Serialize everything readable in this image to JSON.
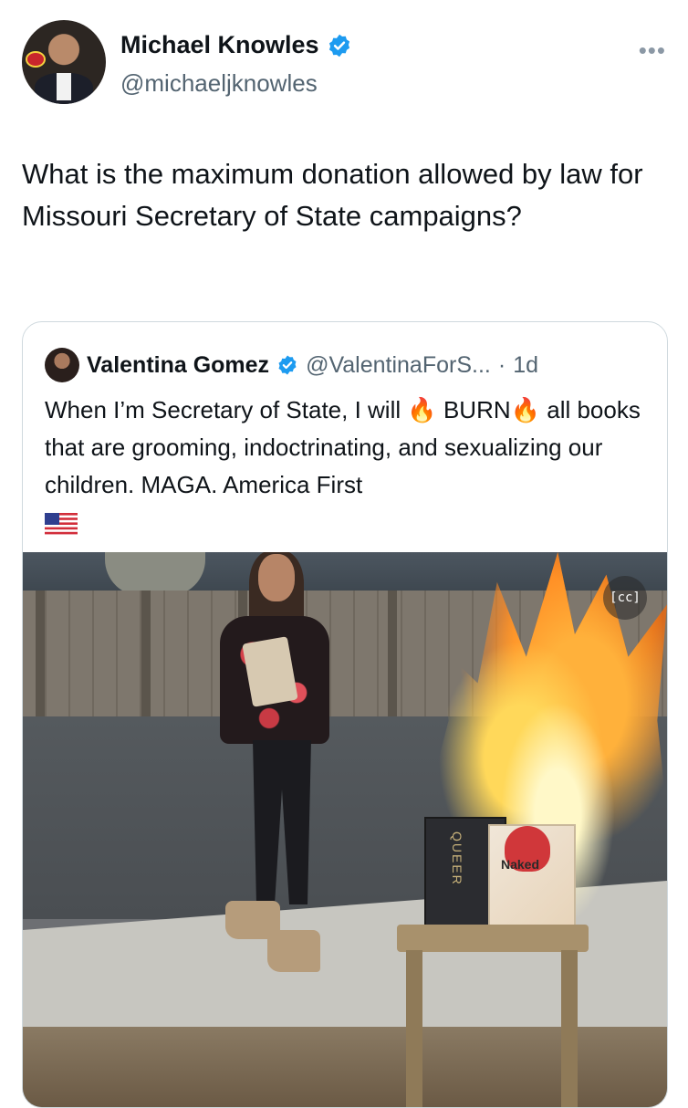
{
  "post": {
    "author_name": "Michael Knowles",
    "author_handle": "@michaeljknowles",
    "more_menu": "•••",
    "text": "What is the maximum donation allowed by law for Missouri Secretary of State campaigns?",
    "avatar_icon": "profile-photo"
  },
  "quoted_post": {
    "author_name": "Valentina Gomez",
    "author_handle": "@ValentinaForS...",
    "separator": "·",
    "time": "1d",
    "text_part1": "When I’m Secretary of State, I will ",
    "emoji_fire": "🔥",
    "text_burn": "BURN",
    "text_part2": " all books that are grooming, indoctrinating, and sexualizing our children. MAGA. America First",
    "flag_icon": "us-flag-emoji",
    "media": {
      "type": "video-thumbnail",
      "caption_badge": "[cc]",
      "book_left_title": "QUEER",
      "book_right_title": "Naked"
    }
  },
  "colors": {
    "verified_blue": "#1d9bf0",
    "secondary_text": "#536471",
    "border": "#cfd9de"
  }
}
